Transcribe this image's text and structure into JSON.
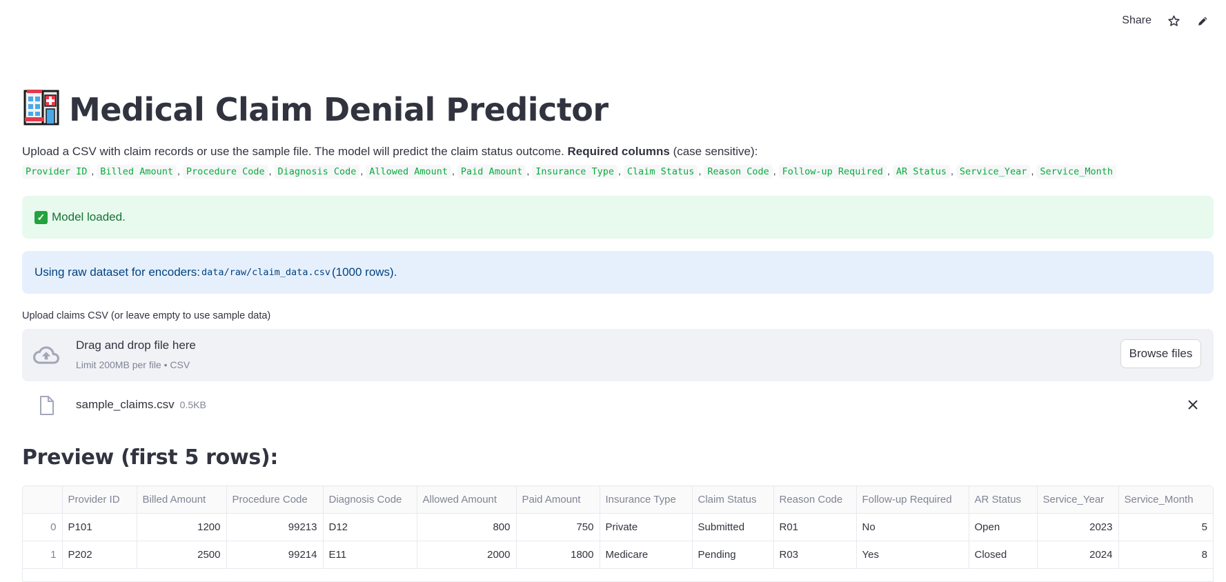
{
  "header": {
    "share_label": "Share",
    "star_icon": "star-icon",
    "edit_icon": "pencil-icon"
  },
  "page": {
    "title_emoji": "hospital",
    "title": "Medical Claim Denial Predictor",
    "intro_text": "Upload a CSV with claim records or use the sample file. The model will predict the claim status outcome. ",
    "intro_bold": "Required columns",
    "intro_suffix": " (case sensitive):",
    "required_columns": [
      "Provider ID",
      "Billed Amount",
      "Procedure Code",
      "Diagnosis Code",
      "Allowed Amount",
      "Paid Amount",
      "Insurance Type",
      "Claim Status",
      "Reason Code",
      "Follow-up Required",
      "AR Status",
      "Service_Year",
      "Service_Month"
    ]
  },
  "alerts": {
    "success": "Model loaded.",
    "info_prefix": "Using raw dataset for encoders: ",
    "info_path": "data/raw/claim_data.csv",
    "info_suffix": " (1000 rows)."
  },
  "uploader": {
    "label": "Upload claims CSV (or leave empty to use sample data)",
    "drag_text": "Drag and drop file here",
    "limit_text": "Limit 200MB per file • CSV",
    "browse_label": "Browse files",
    "file_name": "sample_claims.csv",
    "file_size": "0.5KB"
  },
  "preview": {
    "heading": "Preview (first 5 rows):",
    "columns": [
      "",
      "Provider ID",
      "Billed Amount",
      "Procedure Code",
      "Diagnosis Code",
      "Allowed Amount",
      "Paid Amount",
      "Insurance Type",
      "Claim Status",
      "Reason Code",
      "Follow-up Required",
      "AR Status",
      "Service_Year",
      "Service_Month"
    ],
    "rows": [
      [
        "0",
        "P101",
        "1200",
        "99213",
        "D12",
        "800",
        "750",
        "Private",
        "Submitted",
        "R01",
        "No",
        "Open",
        "2023",
        "5"
      ],
      [
        "1",
        "P202",
        "2500",
        "99214",
        "E11",
        "2000",
        "1800",
        "Medicare",
        "Pending",
        "R03",
        "Yes",
        "Closed",
        "2024",
        "8"
      ]
    ],
    "numeric_columns": [
      2,
      3,
      5,
      6,
      12,
      13
    ]
  },
  "colors": {
    "success_bg": "#e8f9ee",
    "success_text": "#177233",
    "info_bg": "#e6f0fc",
    "info_text": "#004280",
    "code_green": "#09ab3b"
  }
}
